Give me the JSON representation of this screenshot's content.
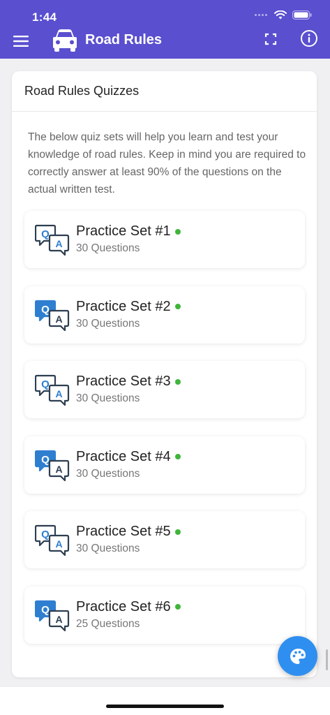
{
  "status_bar": {
    "time": "1:44"
  },
  "app_bar": {
    "title": "Road Rules",
    "icons": {
      "menu": "menu-icon",
      "logo": "car-icon",
      "fullscreen": "fullscreen-icon",
      "info": "info-icon"
    }
  },
  "card": {
    "header": "Road Rules Quizzes",
    "intro": "The below quiz sets will help you learn and test your knowledge of road rules. Keep in mind you are required to correctly answer at least 90% of the questions on the actual written test."
  },
  "quizzes": [
    {
      "title": "Practice Set #1",
      "subtitle": "30 Questions"
    },
    {
      "title": "Practice Set #2",
      "subtitle": "30 Questions"
    },
    {
      "title": "Practice Set #3",
      "subtitle": "30 Questions"
    },
    {
      "title": "Practice Set #4",
      "subtitle": "30 Questions"
    },
    {
      "title": "Practice Set #5",
      "subtitle": "30 Questions"
    },
    {
      "title": "Practice Set #6",
      "subtitle": "25 Questions"
    }
  ],
  "colors": {
    "primary": "#5a4fcf",
    "accent_blue": "#2f8ff0",
    "status_dot": "#3fb53a",
    "icon_blue": "#2f7fd0",
    "icon_dark": "#2d3e50"
  },
  "fab": {
    "icon": "palette-icon"
  }
}
